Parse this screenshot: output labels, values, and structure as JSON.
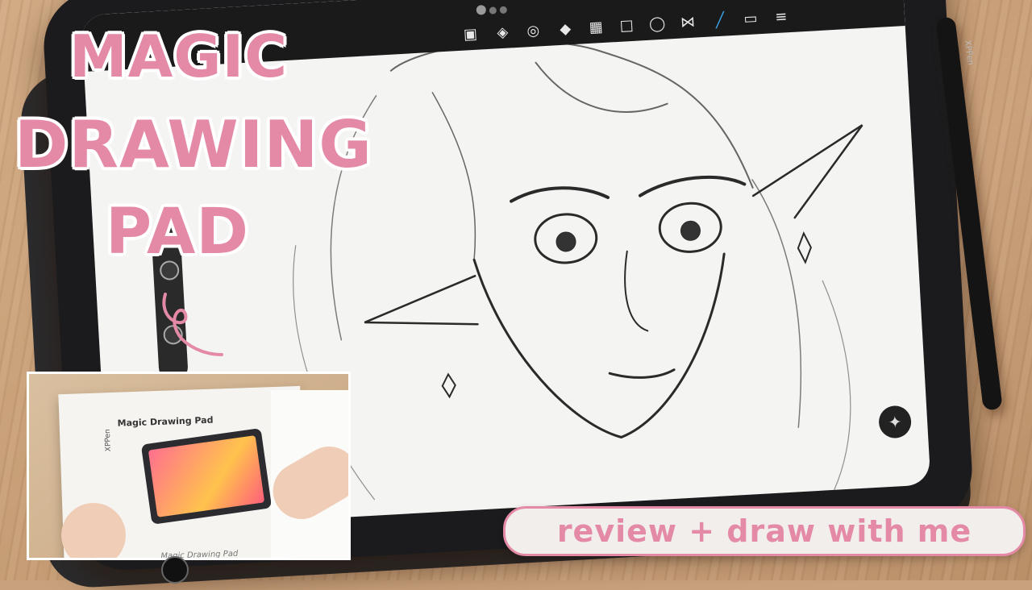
{
  "title": {
    "line1": "MAGIC",
    "line2": "DRAWING",
    "line3": "PAD"
  },
  "subtitle": "review + draw with me",
  "inset": {
    "box_title": "Magic Drawing Pad",
    "box_brand": "XPPen",
    "box_footer": "Magic Drawing Pad"
  },
  "pen_brand": "XPPen",
  "toolbar": {
    "icons": [
      "save-icon",
      "fill-icon",
      "lasso-icon",
      "drop-icon",
      "grid-icon",
      "square-icon",
      "speech-icon",
      "symmetry-icon",
      "brush-icon",
      "eraser-icon",
      "layers-icon"
    ]
  },
  "colors": {
    "accent_pink": "#e48aa6",
    "accent_blue": "#3aa7e8",
    "tablet_black": "#1b1b1d"
  }
}
